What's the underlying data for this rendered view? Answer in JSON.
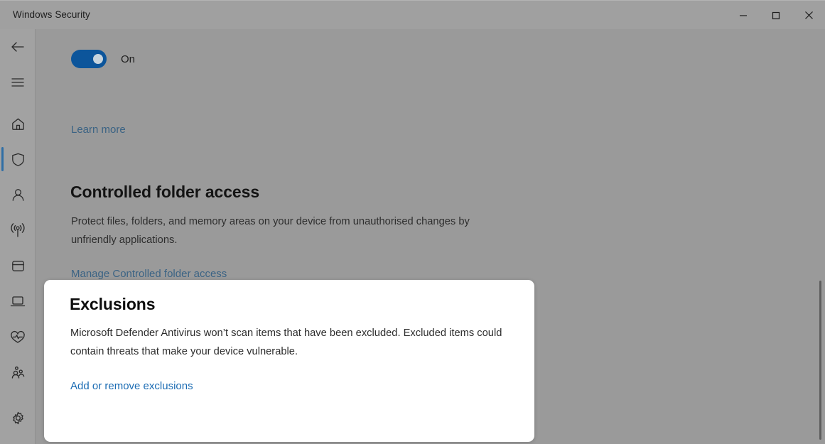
{
  "window": {
    "title": "Windows Security",
    "controls": {
      "minimize": "minimize-button",
      "maximize": "maximize-button",
      "close": "close-button"
    }
  },
  "sidebar": {
    "back_icon": "back-arrow-icon",
    "menu_icon": "hamburger-menu-icon",
    "items": [
      {
        "icon": "home-icon",
        "name": "home",
        "selected": false
      },
      {
        "icon": "shield-icon",
        "name": "virus-and-threat-protection",
        "selected": true
      },
      {
        "icon": "person-icon",
        "name": "account-protection",
        "selected": false
      },
      {
        "icon": "wifi-signal-icon",
        "name": "firewall-and-network-protection",
        "selected": false
      },
      {
        "icon": "app-window-icon",
        "name": "app-and-browser-control",
        "selected": false
      },
      {
        "icon": "laptop-icon",
        "name": "device-security",
        "selected": false
      },
      {
        "icon": "heart-pulse-icon",
        "name": "device-performance-and-health",
        "selected": false
      },
      {
        "icon": "family-people-icon",
        "name": "family-options",
        "selected": false
      },
      {
        "icon": "gear-icon",
        "name": "settings",
        "selected": false
      }
    ]
  },
  "content": {
    "toggle": {
      "state_label": "On",
      "checked": true,
      "accent_color": "#0c559b"
    },
    "learn_more_link": "Learn more",
    "controlled_folder_access": {
      "heading": "Controlled folder access",
      "body": "Protect files, folders, and memory areas on your device from unauthorised changes by unfriendly applications.",
      "link": "Manage Controlled folder access"
    }
  },
  "card": {
    "heading": "Exclusions",
    "body": "Microsoft Defender Antivirus won’t scan items that have been excluded. Excluded items could contain threats that make your device vulnerable.",
    "link": "Add or remove exclusions",
    "link_color": "#1a6bb3",
    "background": "#ffffff"
  },
  "colors": {
    "page_background": "#9a9a9a",
    "sidebar_background": "#a2a2a2",
    "titlebar_background": "#a0a0a0",
    "dimmed_link": "#3b6384",
    "selection_indicator": "#2f6ea5"
  },
  "scrollbar": {
    "name": "vertical-scrollbar"
  }
}
